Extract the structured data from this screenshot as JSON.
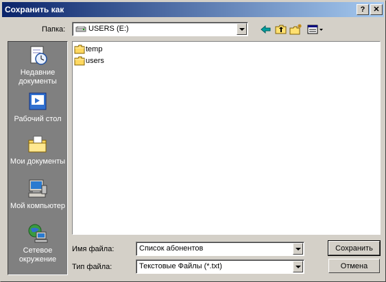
{
  "window": {
    "title": "Сохранить как"
  },
  "titlebar_buttons": {
    "help": "?",
    "close": "✕"
  },
  "location": {
    "label": "Папка:",
    "value": "USERS (E:)"
  },
  "places": [
    {
      "label": "Недавние документы",
      "icon": "recent-documents-icon"
    },
    {
      "label": "Рабочий стол",
      "icon": "desktop-icon"
    },
    {
      "label": "Мои документы",
      "icon": "my-documents-icon"
    },
    {
      "label": "Мой компьютер",
      "icon": "my-computer-icon"
    },
    {
      "label": "Сетевое окружение",
      "icon": "network-icon"
    }
  ],
  "files": [
    {
      "name": "temp",
      "type": "folder"
    },
    {
      "name": "users",
      "type": "folder"
    }
  ],
  "filename": {
    "label": "Имя файла:",
    "value": "Список абонентов"
  },
  "filetype": {
    "label": "Тип файла:",
    "value": "Текстовые Файлы (*.txt)"
  },
  "buttons": {
    "save": "Сохранить",
    "cancel": "Отмена"
  }
}
